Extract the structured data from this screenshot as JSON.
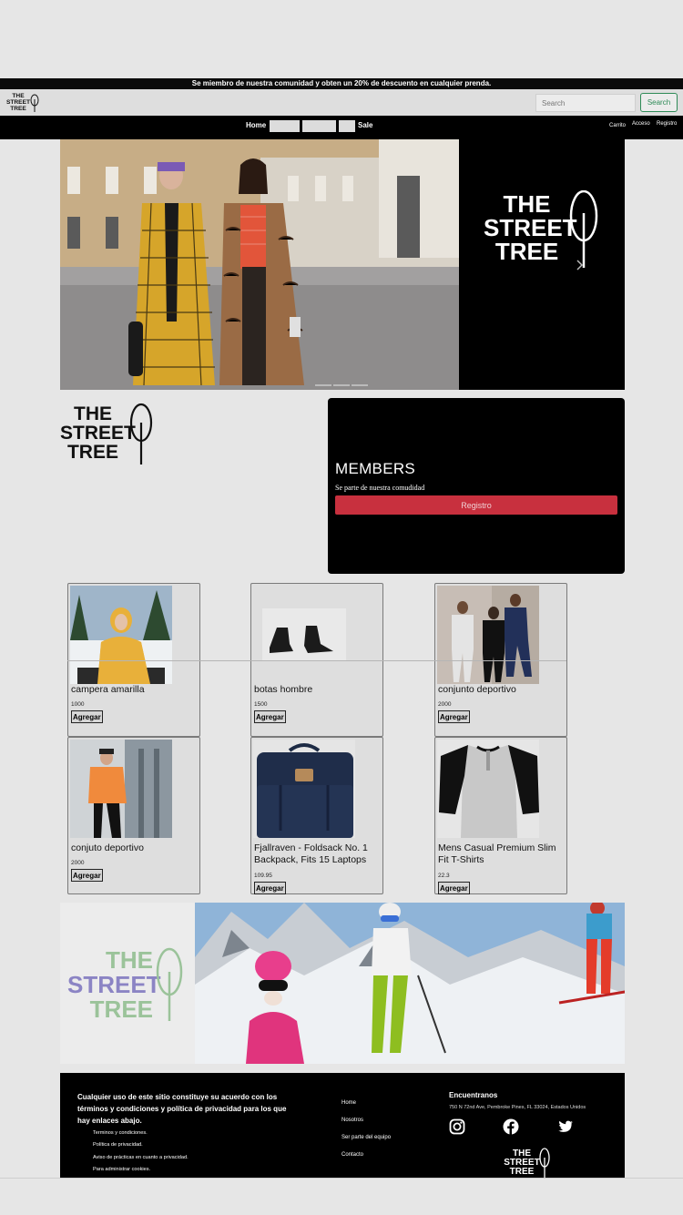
{
  "promo": {
    "text": "Se miembro de nuestra comunidad y obten un 20% de descuento en cualquier prenda."
  },
  "brand": {
    "line1": "THE",
    "line2": "STREET",
    "line3": "TREE"
  },
  "search": {
    "placeholder": "Search",
    "button": "Search"
  },
  "nav": {
    "home": "Home",
    "sale": "Sale",
    "cart": "Carrito",
    "login": "Acceso",
    "register": "Registro"
  },
  "members": {
    "title": "MEMBERS",
    "subtitle": "Se parte de nuestra comudidad",
    "button": "Registro"
  },
  "products": [
    {
      "name": "campera amarilla",
      "price": "1000",
      "button": "Agregar"
    },
    {
      "name": "botas hombre",
      "price": "1500",
      "button": "Agregar"
    },
    {
      "name": "conjunto deportivo",
      "price": "2000",
      "button": "Agregar"
    },
    {
      "name": "conjuto deportivo",
      "price": "2000",
      "button": "Agregar"
    },
    {
      "name": "Fjallraven - Foldsack No. 1 Backpack, Fits 15 Laptops",
      "price": "109.95",
      "button": "Agregar"
    },
    {
      "name": "Mens Casual Premium Slim Fit T-Shirts",
      "price": "22.3",
      "button": "Agregar"
    }
  ],
  "footer": {
    "terms": "Cualquier uso de este sitio constituye su acuerdo con los términos y condiciones y política de privacidad para los que hay enlaces abajo.",
    "links": [
      "Terminos y condiciones.",
      "Política de privacidad.",
      "Aviso de prácticas en cuanto a privacidad.",
      "Para administrar cookies."
    ],
    "nav": [
      "Home",
      "Nosotros",
      "Ser parte del equipo",
      "Contacto"
    ],
    "find_title": "Encuentranos",
    "address": "750 N 72nd Ave, Pembroke Pines, FL 33024, Estados Unidos",
    "social": [
      "instagram-icon",
      "facebook-icon",
      "twitter-icon"
    ]
  },
  "colors": {
    "accent_red": "#c8303e",
    "search_green": "#2e8b57",
    "banner_purple": "#8b84c4",
    "banner_green": "#9bc39a"
  }
}
